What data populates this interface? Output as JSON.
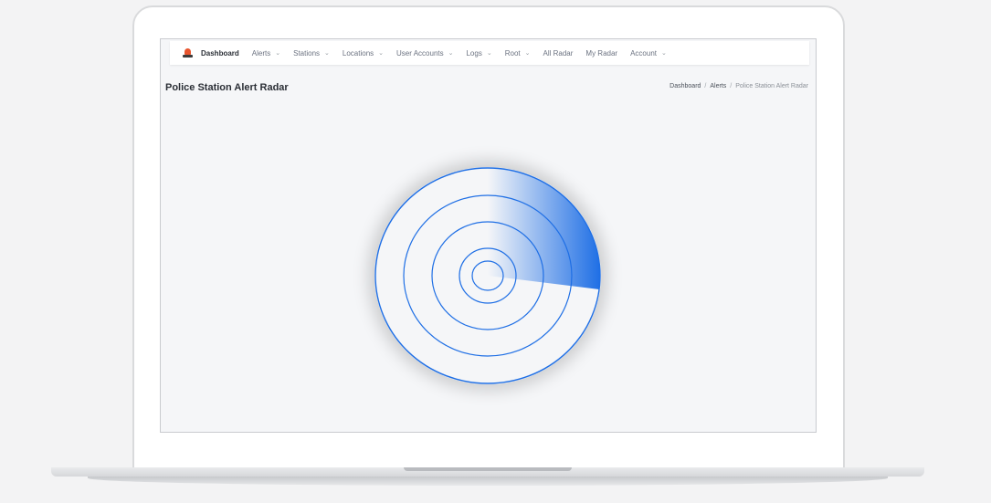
{
  "navbar": {
    "brand": "Dashboard",
    "items": [
      {
        "label": "Alerts",
        "dropdown": true
      },
      {
        "label": "Stations",
        "dropdown": true
      },
      {
        "label": "Locations",
        "dropdown": true
      },
      {
        "label": "User Accounts",
        "dropdown": true
      },
      {
        "label": "Logs",
        "dropdown": true
      },
      {
        "label": "Root",
        "dropdown": true
      },
      {
        "label": "All Radar",
        "dropdown": false
      },
      {
        "label": "My Radar",
        "dropdown": false
      },
      {
        "label": "Account",
        "dropdown": true
      }
    ],
    "chevron": "⌄"
  },
  "page": {
    "title": "Police Station Alert Radar"
  },
  "breadcrumb": {
    "items": [
      "Dashboard",
      "Alerts",
      "Police Station Alert Radar"
    ],
    "separator": "/"
  },
  "colors": {
    "accent": "#1f6fe5",
    "radar_ring": "#1f6fe5",
    "brand_icon": "#e8552e"
  },
  "icons": {
    "brand": "police-siren-icon",
    "dropdown": "chevron-down-icon"
  }
}
